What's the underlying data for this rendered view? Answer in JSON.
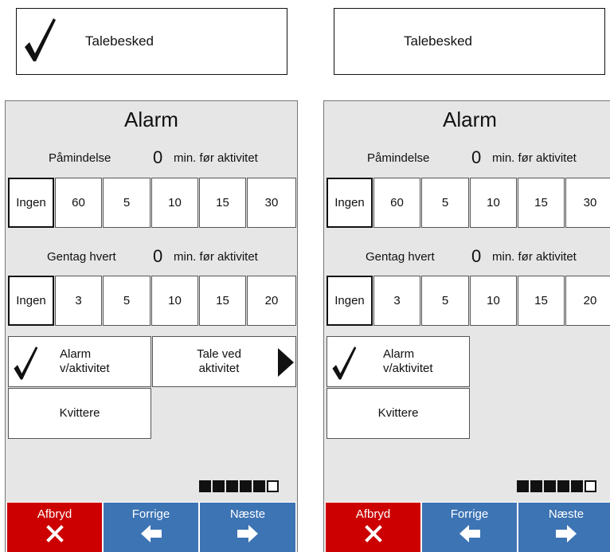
{
  "top_buttons": {
    "left_label": "Talebesked",
    "right_label": "Talebesked"
  },
  "panels": [
    {
      "title": "Alarm",
      "reminder": {
        "label": "Påmindelse",
        "value": "0",
        "suffix": "min. før aktivitet",
        "options": [
          "Ingen",
          "60",
          "5",
          "10",
          "15",
          "30"
        ]
      },
      "repeat": {
        "label": "Gentag hvert",
        "value": "0",
        "suffix": "min. før aktivitet",
        "options": [
          "Ingen",
          "3",
          "5",
          "10",
          "15",
          "20"
        ]
      },
      "alarm_activity_label": "Alarm v/aktivitet",
      "speech_label": "Tale ved aktivitet",
      "acknowledge_label": "Kvittere",
      "progress": {
        "filled": 5,
        "total": 6
      },
      "nav": {
        "cancel": "Afbryd",
        "previous": "Forrige",
        "next": "Næste"
      }
    },
    {
      "title": "Alarm",
      "reminder": {
        "label": "Påmindelse",
        "value": "0",
        "suffix": "min. før aktivitet",
        "options": [
          "Ingen",
          "60",
          "5",
          "10",
          "15",
          "30"
        ]
      },
      "repeat": {
        "label": "Gentag hvert",
        "value": "0",
        "suffix": "min. før aktivitet",
        "options": [
          "Ingen",
          "3",
          "5",
          "10",
          "15",
          "20"
        ]
      },
      "alarm_activity_label": "Alarm v/aktivitet",
      "acknowledge_label": "Kvittere",
      "progress": {
        "filled": 5,
        "total": 6
      },
      "nav": {
        "cancel": "Afbryd",
        "previous": "Forrige",
        "next": "Næste"
      }
    }
  ],
  "colors": {
    "cancel": "#cc0000",
    "nav": "#3d74b4",
    "panel_bg": "#e6e6e6"
  }
}
